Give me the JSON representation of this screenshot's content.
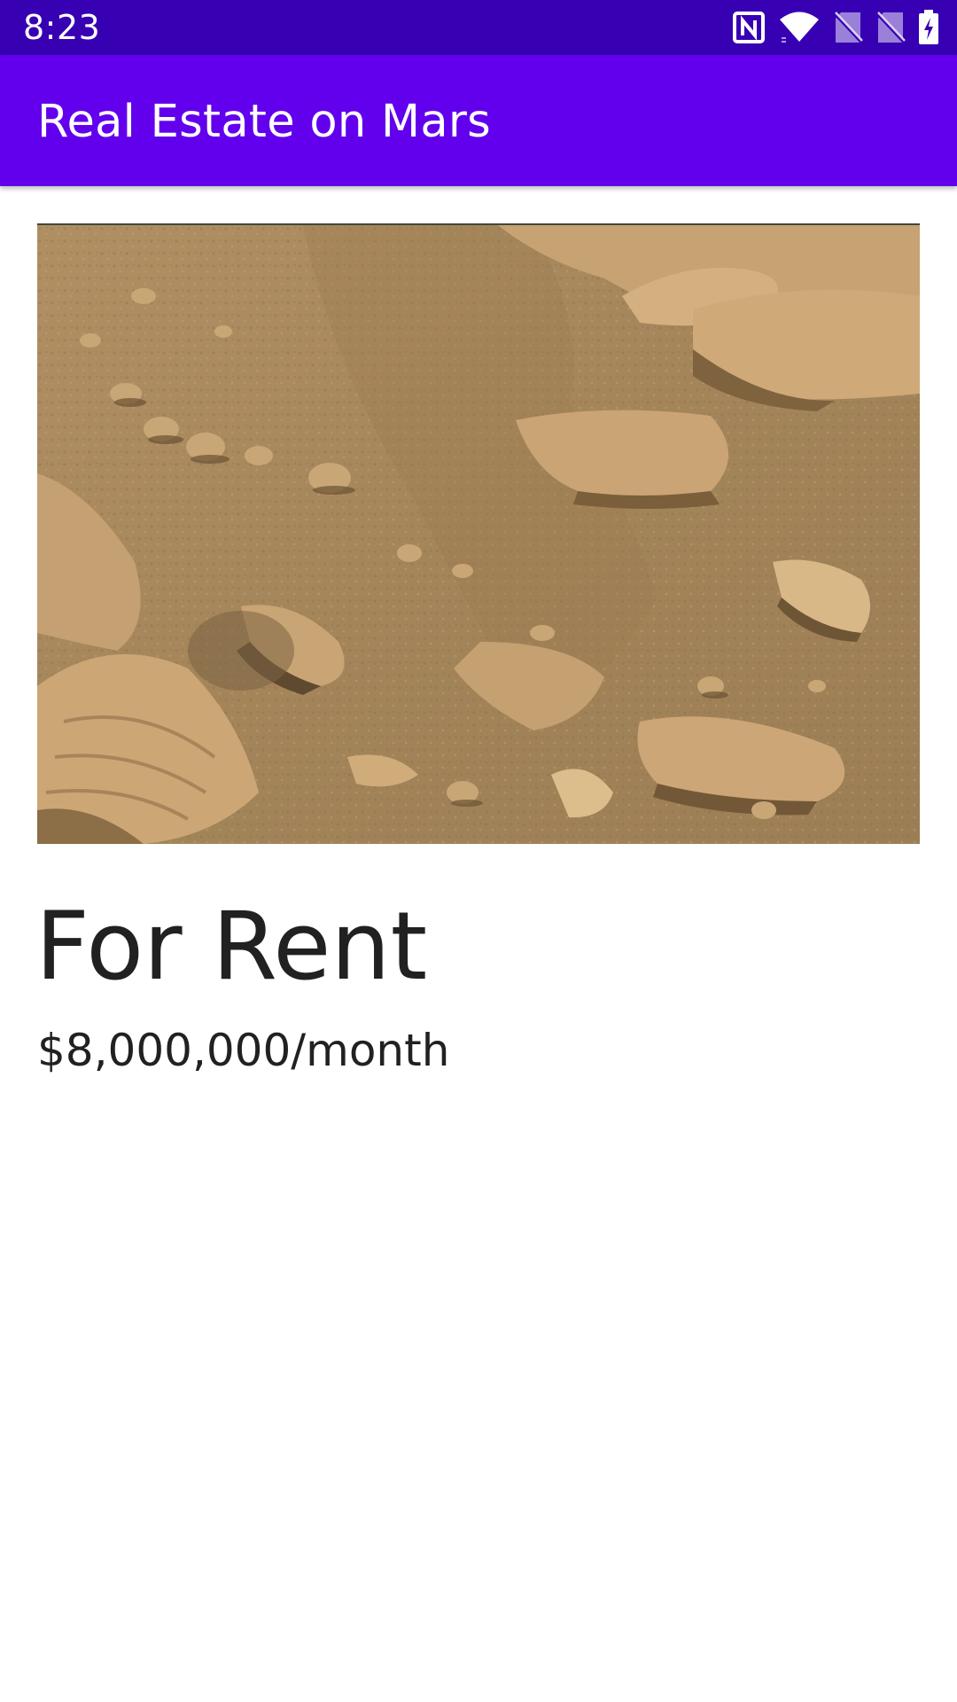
{
  "status_bar": {
    "time": "8:23",
    "icons": [
      "nfc-icon",
      "wifi-icon",
      "sim-no-signal-icon",
      "sim-no-signal-icon",
      "battery-charging-icon"
    ]
  },
  "app_bar": {
    "title": "Real Estate on Mars",
    "color": "#6200ee",
    "status_color": "#3700b3"
  },
  "property": {
    "image": "mars-terrain-photo",
    "type": "For Rent",
    "price": "$8,000,000/month"
  }
}
